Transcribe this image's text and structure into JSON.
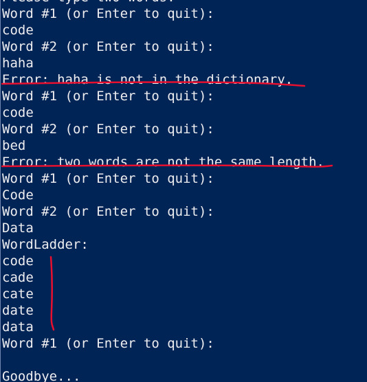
{
  "terminal": {
    "background_color": "#012456",
    "text_color": "#eeedf0",
    "annotation_color": "#e8102e",
    "lines": [
      "Please type two words:",
      "Word #1 (or Enter to quit):",
      "code",
      "Word #2 (or Enter to quit):",
      "haha",
      "Error: haha is not in the dictionary.",
      "Word #1 (or Enter to quit):",
      "code",
      "Word #2 (or Enter to quit):",
      "bed",
      "Error: two words are not the same length.",
      "Word #1 (or Enter to quit):",
      "Code",
      "Word #2 (or Enter to quit):",
      "Data",
      "WordLadder:",
      "code",
      "cade",
      "cate",
      "date",
      "data",
      "Word #1 (or Enter to quit):",
      "",
      "Goodbye..."
    ]
  }
}
